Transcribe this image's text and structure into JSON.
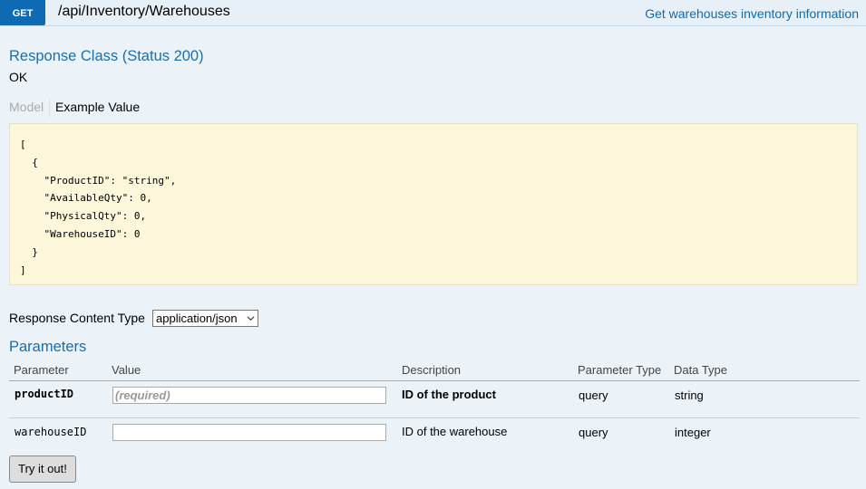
{
  "header": {
    "method": "GET",
    "path": "/api/Inventory/Warehouses",
    "summary": "Get warehouses inventory information"
  },
  "response": {
    "title": "Response Class (Status 200)",
    "status_text": "OK",
    "tabs": [
      {
        "label": "Model",
        "active": false
      },
      {
        "label": "Example Value",
        "active": true
      }
    ],
    "example_value": "[\n  {\n    \"ProductID\": \"string\",\n    \"AvailableQty\": 0,\n    \"PhysicalQty\": 0,\n    \"WarehouseID\": 0\n  }\n]"
  },
  "content_type": {
    "label": "Response Content Type",
    "selected": "application/json"
  },
  "parameters": {
    "title": "Parameters",
    "columns": [
      "Parameter",
      "Value",
      "Description",
      "Parameter Type",
      "Data Type"
    ],
    "rows": [
      {
        "name": "productID",
        "placeholder": "(required)",
        "description": "ID of the product",
        "param_type": "query",
        "data_type": "string",
        "required": true
      },
      {
        "name": "warehouseID",
        "placeholder": "",
        "description": "ID of the warehouse",
        "param_type": "query",
        "data_type": "integer",
        "required": false
      }
    ]
  },
  "try_button": "Try it out!",
  "colors": {
    "accent": "#0f6ab4",
    "section_title": "#1b6db2",
    "background": "#ebf3f9",
    "code_background": "#fcf6db"
  }
}
